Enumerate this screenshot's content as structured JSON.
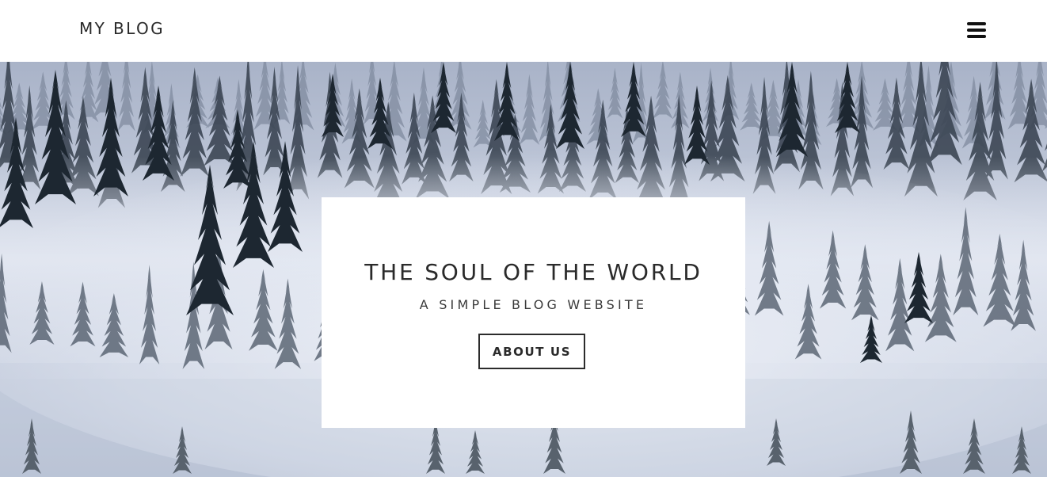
{
  "header": {
    "brand": "MY BLOG",
    "menu_icon": "hamburger-icon"
  },
  "hero": {
    "background": "misty pine forest",
    "title": "THE SOUL OF THE WORLD",
    "subtitle": "A SIMPLE BLOG WEBSITE",
    "button_label": "ABOUT US"
  },
  "colors": {
    "text": "#2a2a2a",
    "card_bg": "#ffffff",
    "fog": "#d9dfeb",
    "trees": "#1f2a33"
  }
}
